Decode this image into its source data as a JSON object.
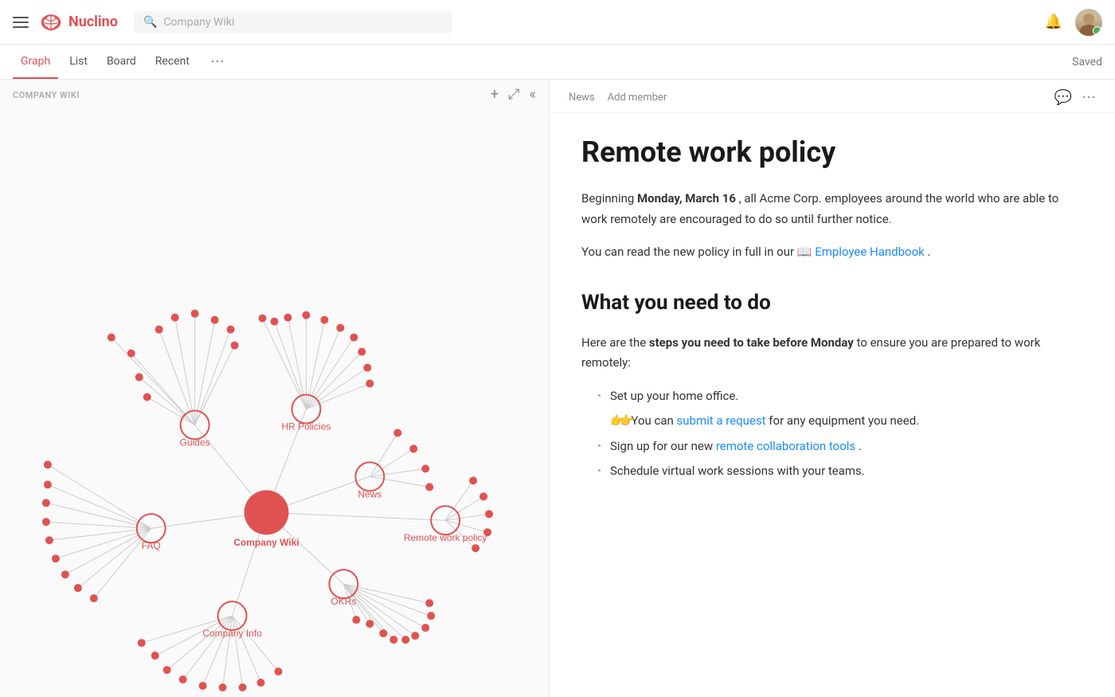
{
  "navbar": {
    "logo_text": "Nuclino",
    "search_placeholder": "Company Wiki",
    "saved_label": "Saved"
  },
  "tabs": [
    {
      "id": "graph",
      "label": "Graph",
      "active": true
    },
    {
      "id": "list",
      "label": "List",
      "active": false
    },
    {
      "id": "board",
      "label": "Board",
      "active": false
    },
    {
      "id": "recent",
      "label": "Recent",
      "active": false
    }
  ],
  "graph_panel": {
    "label": "COMPANY WIKI",
    "add_btn": "+",
    "expand_btn": "⤢",
    "collapse_btn": "«"
  },
  "doc": {
    "breadcrumb_news": "News",
    "breadcrumb_add_member": "Add member",
    "title": "Remote work policy",
    "intro": "Beginning ",
    "intro_bold": "Monday, March 16",
    "intro_rest": ", all Acme Corp. employees around the world who are able to work remotely are encouraged to do so until further notice.",
    "handbook_line_start": "You can read the new policy in full in our 📖 ",
    "handbook_link": "Employee Handbook",
    "handbook_end": ".",
    "section2_title": "What you need to do",
    "section2_intro_start": "Here are the ",
    "section2_intro_bold": "steps you need to take before Monday",
    "section2_intro_rest": " to ensure you are prepared to work remotely:",
    "list_items": [
      "Set up your home office.",
      "Sign up for our new remote collaboration tools.",
      "Schedule virtual work sessions with your teams."
    ],
    "sub_item": "You can submit a request for any equipment you need.",
    "sub_item_link": "submit a request",
    "collab_link": "remote collaboration tools"
  }
}
